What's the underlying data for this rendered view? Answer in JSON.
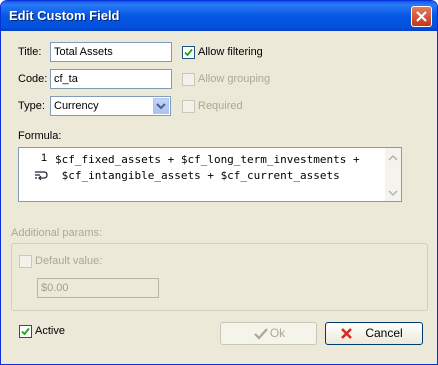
{
  "window": {
    "title": "Edit Custom Field"
  },
  "fields": {
    "title_label": "Title:",
    "title_value": "Total Assets",
    "code_label": "Code:",
    "code_value": "cf_ta",
    "type_label": "Type:",
    "type_value": "Currency"
  },
  "options": {
    "allow_filtering": "Allow filtering",
    "allow_grouping": "Allow grouping",
    "required": "Required"
  },
  "formula": {
    "label": "Formula:",
    "line_number": "1",
    "line1": "$cf_fixed_assets + $cf_long_term_investments +",
    "line2": " $cf_intangible_assets + $cf_current_assets"
  },
  "additional": {
    "label": "Additional params:",
    "default_value_label": "Default value:",
    "default_value": "$0.00"
  },
  "footer": {
    "active_label": "Active",
    "ok_label": "Ok",
    "cancel_label": "Cancel"
  },
  "icons": [
    "close-icon",
    "check-icon",
    "dropdown-arrow-icon",
    "wrap-icon",
    "ok-check-icon",
    "cancel-x-icon"
  ],
  "colors": {
    "titlebar": "#0558e4",
    "dialog_bg": "#ece9d8",
    "cancel_icon": "#d62b1e",
    "check": "#21a121"
  }
}
